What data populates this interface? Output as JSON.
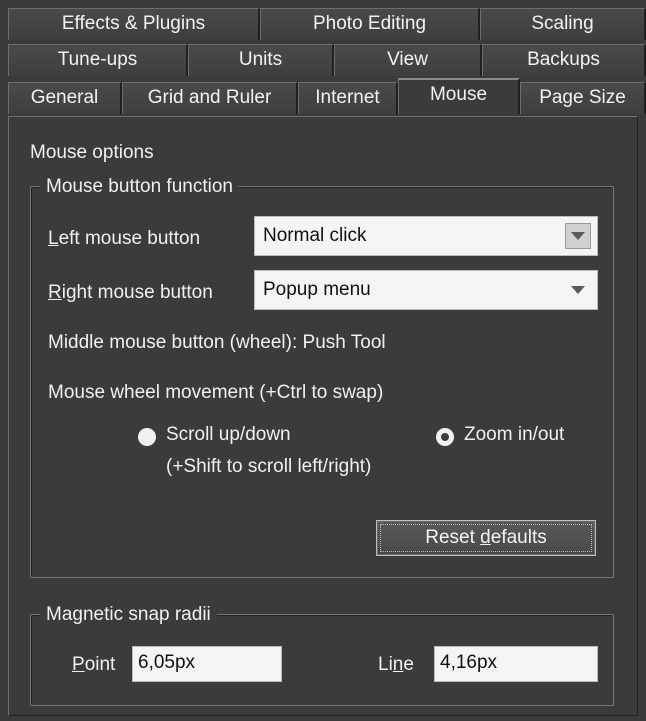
{
  "tabs": {
    "row1": [
      "Effects & Plugins",
      "Photo Editing",
      "Scaling"
    ],
    "row2": [
      "Tune-ups",
      "Units",
      "View",
      "Backups"
    ],
    "row3": [
      "General",
      "Grid and Ruler",
      "Internet",
      "Mouse",
      "Page Size"
    ],
    "active": "Mouse"
  },
  "section": {
    "title": "Mouse options"
  },
  "mouse_button_function": {
    "title": "Mouse button function",
    "left": {
      "label_u": "L",
      "label_rest": "eft mouse button",
      "value": "Normal click"
    },
    "right": {
      "label_u": "R",
      "label_rest": "ight mouse button",
      "value": "Popup menu"
    },
    "middle": "Middle mouse button (wheel): Push Tool",
    "wheel_title": "Mouse wheel movement (+Ctrl to swap)",
    "scroll_option": "Scroll up/down",
    "scroll_hint": "(+Shift to scroll left/right)",
    "zoom_option": "Zoom in/out",
    "selected_wheel_option": "Zoom in/out",
    "reset_pre": "Reset ",
    "reset_u": "d",
    "reset_post": "efaults"
  },
  "magnetic": {
    "title": "Magnetic snap radii",
    "point_label_u": "P",
    "point_label_rest": "oint",
    "point_value": "6,05px",
    "line_label_pre": "Li",
    "line_label_u": "n",
    "line_label_rest": "e",
    "line_value": "4,16px"
  }
}
